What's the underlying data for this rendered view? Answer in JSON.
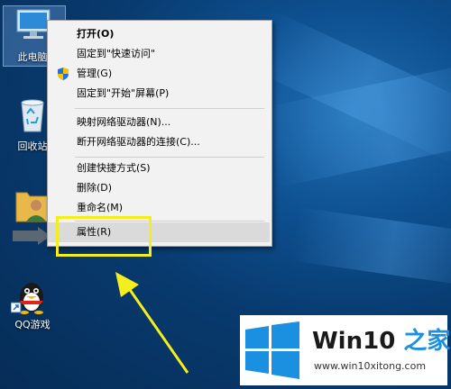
{
  "desktop": {
    "icons": [
      {
        "label": "此电脑",
        "icon": "computer-icon"
      },
      {
        "label": "回收站",
        "icon": "recycle-bin-icon"
      },
      {
        "label": "",
        "icon": "user-folder-icon"
      },
      {
        "label": "QQ游戏",
        "icon": "qq-penguin-icon"
      }
    ]
  },
  "context_menu": {
    "items": {
      "open": "打开(O)",
      "pin_quick_access": "固定到\"快速访问\"",
      "manage": "管理(G)",
      "pin_start": "固定到\"开始\"屏幕(P)",
      "map_drive": "映射网络驱动器(N)...",
      "disconnect_drive": "断开网络驱动器的连接(C)...",
      "create_shortcut": "创建快捷方式(S)",
      "delete": "删除(D)",
      "rename": "重命名(M)",
      "properties": "属性(R)"
    },
    "highlighted": "properties"
  },
  "annotation": {
    "highlight_color": "#f4ef1c",
    "arrow_color": "#f4ef1c"
  },
  "watermark": {
    "title_main": "Win10 ",
    "title_accent": "之家",
    "url": "www.win10xitong.com",
    "brand_color": "#1b8fe0"
  }
}
